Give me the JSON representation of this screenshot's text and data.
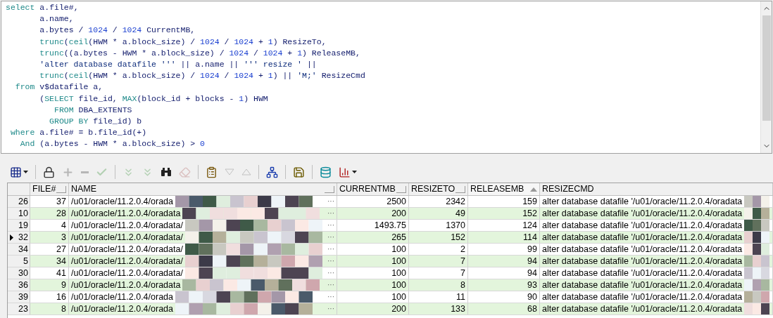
{
  "editor": {
    "lines": [
      [
        {
          "kind": "keyword",
          "text": "select"
        },
        {
          "kind": "plain",
          "text": " a.file#,"
        }
      ],
      [
        {
          "kind": "plain",
          "text": "       a.name,"
        }
      ],
      [
        {
          "kind": "plain",
          "text": "       a.bytes / "
        },
        {
          "kind": "number",
          "text": "1024"
        },
        {
          "kind": "plain",
          "text": " / "
        },
        {
          "kind": "number",
          "text": "1024"
        },
        {
          "kind": "plain",
          "text": " CurrentMB,"
        }
      ],
      [
        {
          "kind": "keyword",
          "text": "       trunc"
        },
        {
          "kind": "plain",
          "text": "("
        },
        {
          "kind": "keyword",
          "text": "ceil"
        },
        {
          "kind": "plain",
          "text": "(HWM * a.block_size) / "
        },
        {
          "kind": "number",
          "text": "1024"
        },
        {
          "kind": "plain",
          "text": " / "
        },
        {
          "kind": "number",
          "text": "1024"
        },
        {
          "kind": "plain",
          "text": " + "
        },
        {
          "kind": "number",
          "text": "1"
        },
        {
          "kind": "plain",
          "text": ") ResizeTo,"
        }
      ],
      [
        {
          "kind": "keyword",
          "text": "       trunc"
        },
        {
          "kind": "plain",
          "text": "((a.bytes - HWM * a.block_size) / "
        },
        {
          "kind": "number",
          "text": "1024"
        },
        {
          "kind": "plain",
          "text": " / "
        },
        {
          "kind": "number",
          "text": "1024"
        },
        {
          "kind": "plain",
          "text": " + "
        },
        {
          "kind": "number",
          "text": "1"
        },
        {
          "kind": "plain",
          "text": ") ReleaseMB,"
        }
      ],
      [
        {
          "kind": "string",
          "text": "       'alter database datafile '''"
        },
        {
          "kind": "plain",
          "text": " || a.name || "
        },
        {
          "kind": "string",
          "text": "''' resize '"
        },
        {
          "kind": "plain",
          "text": " ||"
        }
      ],
      [
        {
          "kind": "keyword",
          "text": "       trunc"
        },
        {
          "kind": "plain",
          "text": "("
        },
        {
          "kind": "keyword",
          "text": "ceil"
        },
        {
          "kind": "plain",
          "text": "(HWM * a.block_size) / "
        },
        {
          "kind": "number",
          "text": "1024"
        },
        {
          "kind": "plain",
          "text": " / "
        },
        {
          "kind": "number",
          "text": "1024"
        },
        {
          "kind": "plain",
          "text": " + "
        },
        {
          "kind": "number",
          "text": "1"
        },
        {
          "kind": "plain",
          "text": ") || "
        },
        {
          "kind": "string",
          "text": "'M;'"
        },
        {
          "kind": "plain",
          "text": " ResizeCmd"
        }
      ],
      [
        {
          "kind": "keyword",
          "text": "  from"
        },
        {
          "kind": "plain",
          "text": " v$datafile a,"
        }
      ],
      [
        {
          "kind": "plain",
          "text": "       ("
        },
        {
          "kind": "keyword",
          "text": "SELECT"
        },
        {
          "kind": "plain",
          "text": " file_id, "
        },
        {
          "kind": "keyword",
          "text": "MAX"
        },
        {
          "kind": "plain",
          "text": "(block_id + blocks - "
        },
        {
          "kind": "number",
          "text": "1"
        },
        {
          "kind": "plain",
          "text": ") HWM"
        }
      ],
      [
        {
          "kind": "keyword",
          "text": "          FROM"
        },
        {
          "kind": "plain",
          "text": " DBA_EXTENTS"
        }
      ],
      [
        {
          "kind": "keyword",
          "text": "         GROUP BY"
        },
        {
          "kind": "plain",
          "text": " file_id) b"
        }
      ],
      [
        {
          "kind": "keyword",
          "text": " where"
        },
        {
          "kind": "plain",
          "text": " a.file# = b.file_id(+)"
        }
      ],
      [
        {
          "kind": "keyword",
          "text": "   And"
        },
        {
          "kind": "plain",
          "text": " (a.bytes - HWM * a.block_size) > "
        },
        {
          "kind": "number",
          "text": "0"
        }
      ]
    ]
  },
  "toolbar": [
    {
      "kind": "grid",
      "disabled": false,
      "dropdown": true
    },
    {
      "kind": "separator"
    },
    {
      "kind": "lock",
      "disabled": false
    },
    {
      "kind": "plus",
      "disabled": true
    },
    {
      "kind": "minus",
      "disabled": true
    },
    {
      "kind": "check",
      "disabled": true
    },
    {
      "kind": "separator"
    },
    {
      "kind": "chevrons",
      "disabled": true
    },
    {
      "kind": "chevrons",
      "disabled": true
    },
    {
      "kind": "binoculars",
      "disabled": false
    },
    {
      "kind": "eraser",
      "disabled": true
    },
    {
      "kind": "separator"
    },
    {
      "kind": "clipboard",
      "disabled": false
    },
    {
      "kind": "triangle-down",
      "disabled": true
    },
    {
      "kind": "triangle-up",
      "disabled": true
    },
    {
      "kind": "separator"
    },
    {
      "kind": "network",
      "disabled": false
    },
    {
      "kind": "separator"
    },
    {
      "kind": "save",
      "disabled": false
    },
    {
      "kind": "separator"
    },
    {
      "kind": "database",
      "disabled": false
    },
    {
      "kind": "chart",
      "disabled": false,
      "dropdown": true
    }
  ],
  "table": {
    "columns": [
      {
        "label": "FILE#",
        "sorted": false
      },
      {
        "label": "NAME",
        "sorted": false
      },
      {
        "label": "CURRENTMB",
        "sorted": false
      },
      {
        "label": "RESIZETO",
        "sorted": false
      },
      {
        "label": "RELEASEMB",
        "sorted": true
      },
      {
        "label": "RESIZECMD",
        "sorted": false
      }
    ],
    "rows": [
      {
        "row": "26",
        "selected": false,
        "cells": [
          "37",
          "/u01/oracle/11.2.0.4/orada",
          "2500",
          "2342",
          "159",
          "alter database datafile '/u01/oracle/11.2.0.4/oradata"
        ],
        "more": "···"
      },
      {
        "row": "10",
        "selected": false,
        "cells": [
          "28",
          "/u01/oracle/11.2.0.4/oradata",
          "200",
          "49",
          "152",
          "alter database datafile '/u01/oracle/11.2.0.4/oradata"
        ],
        "more": "···"
      },
      {
        "row": "19",
        "selected": false,
        "cells": [
          "4",
          "/u01/oracle/11.2.0.4/oradata/",
          "1493.75",
          "1370",
          "124",
          "alter database datafile '/u01/oracle/11.2.0.4/oradata"
        ],
        "more": "···"
      },
      {
        "row": "32",
        "selected": true,
        "cells": [
          "3",
          "/u01/oracle/11.2.0.4/oradata/",
          "265",
          "152",
          "114",
          "alter database datafile '/u01/oracle/11.2.0.4/oradata"
        ],
        "more": "···"
      },
      {
        "row": "34",
        "selected": false,
        "cells": [
          "27",
          "/u01/oracle/11.2.0.4/oradata/",
          "100",
          "2",
          "99",
          "alter database datafile '/u01/oracle/11.2.0.4/oradata"
        ],
        "more": "···"
      },
      {
        "row": "5",
        "selected": false,
        "cells": [
          "34",
          "/u01/oracle/11.2.0.4/oradata/",
          "100",
          "7",
          "94",
          "alter database datafile '/u01/oracle/11.2.0.4/oradata"
        ],
        "more": "···"
      },
      {
        "row": "30",
        "selected": false,
        "cells": [
          "41",
          "/u01/oracle/11.2.0.4/oradata/",
          "100",
          "7",
          "94",
          "alter database datafile '/u01/oracle/11.2.0.4/oradata"
        ],
        "more": "···"
      },
      {
        "row": "36",
        "selected": false,
        "cells": [
          "9",
          "/u01/oracle/11.2.0.4/oradata",
          "100",
          "8",
          "93",
          "alter database datafile '/u01/oracle/11.2.0.4/oradata"
        ],
        "more": "···"
      },
      {
        "row": "39",
        "selected": false,
        "cells": [
          "16",
          "/u01/oracle/11.2.0.4/orada",
          "100",
          "11",
          "90",
          "alter database datafile '/u01/oracle/11.2.0.4/oradata"
        ],
        "more": "···"
      },
      {
        "row": "23",
        "selected": false,
        "cells": [
          "8",
          "/u01/oracle/11.2.0.4/orada",
          "200",
          "133",
          "68",
          "alter database datafile '/u01/oracle/11.2.0.4/oradata"
        ],
        "more": "···"
      }
    ]
  }
}
